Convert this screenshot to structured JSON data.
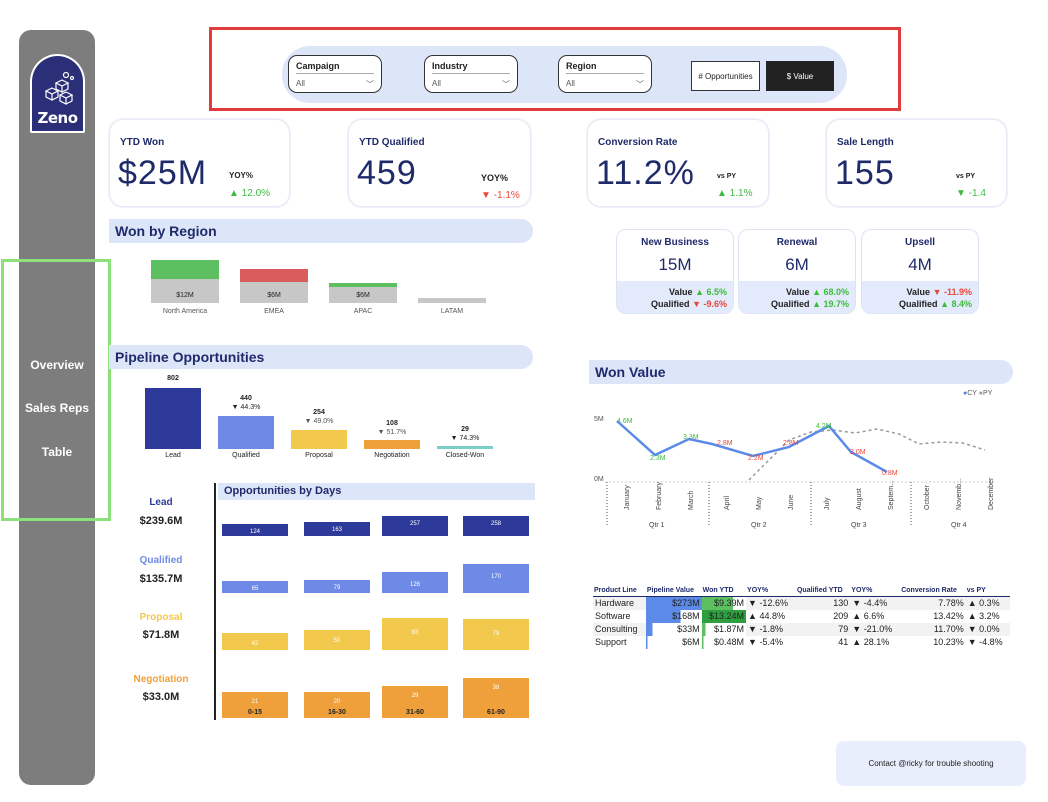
{
  "app": {
    "brand": "Zeno"
  },
  "nav": {
    "items": [
      "Overview",
      "Sales Reps",
      "Table"
    ]
  },
  "filters": {
    "campaign": {
      "label": "Campaign",
      "value": "All"
    },
    "industry": {
      "label": "Industry",
      "value": "All"
    },
    "region": {
      "label": "Region",
      "value": "All"
    },
    "toggle_a": "# Opportunities",
    "toggle_b": "$ Value"
  },
  "kpis": {
    "ytd_won": {
      "title": "YTD Won",
      "value": "$25M",
      "sub": "YOY%",
      "delta": "▲ 12.0%"
    },
    "ytd_qualified": {
      "title": "YTD Qualified",
      "value": "459",
      "sub": "YOY%",
      "delta": "▼ -1.1%"
    },
    "conversion": {
      "title": "Conversion Rate",
      "value": "11.2%",
      "sub": "vs PY",
      "delta": "▲ 1.1%"
    },
    "sale_length": {
      "title": "Sale Length",
      "value": "155",
      "sub": "vs PY",
      "delta": "▼ -1.4"
    }
  },
  "segments": [
    {
      "title": "New Business",
      "value": "15M",
      "value_label": "Value",
      "value_delta": "▲ 6.5%",
      "qual_label": "Qualified",
      "qual_delta": "▼ -9.6%"
    },
    {
      "title": "Renewal",
      "value": "6M",
      "value_label": "Value",
      "value_delta": "▲ 68.0%",
      "qual_label": "Qualified",
      "qual_delta": "▲ 19.7%"
    },
    {
      "title": "Upsell",
      "value": "4M",
      "value_label": "Value",
      "value_delta": "▼ -11.9%",
      "qual_label": "Qualified",
      "qual_delta": "▲ 8.4%"
    }
  ],
  "won_by_region": {
    "title": "Won by Region",
    "regions": [
      {
        "name": "North America",
        "label": "$12M"
      },
      {
        "name": "EMEA",
        "label": "$6M"
      },
      {
        "name": "APAC",
        "label": "$6M"
      },
      {
        "name": "LATAM",
        "label": ""
      }
    ]
  },
  "pipeline": {
    "title": "Pipeline Opportunities",
    "stages": [
      {
        "name": "Lead",
        "value": "802",
        "change": ""
      },
      {
        "name": "Qualified",
        "value": "440",
        "change": "▼ 44.3%"
      },
      {
        "name": "Proposal",
        "value": "254",
        "change": "▼ 49.0%"
      },
      {
        "name": "Negotiation",
        "value": "108",
        "change": "▼ 51.7%"
      },
      {
        "name": "Closed-Won",
        "value": "29",
        "change": "▼ 74.3%"
      }
    ]
  },
  "stage_values": [
    {
      "name": "Lead",
      "value": "$239.6M"
    },
    {
      "name": "Qualified",
      "value": "$135.7M"
    },
    {
      "name": "Proposal",
      "value": "$71.8M"
    },
    {
      "name": "Negotiation",
      "value": "$33.0M"
    }
  ],
  "opps_by_days": {
    "title": "Opportunities by Days",
    "buckets": [
      "0-15",
      "16-30",
      "31-60",
      "61-90"
    ],
    "rows": [
      {
        "stage": "Lead",
        "values": [
          "124",
          "163",
          "257",
          "258"
        ]
      },
      {
        "stage": "Qualified",
        "values": [
          "65",
          "79",
          "126",
          "170"
        ]
      },
      {
        "stage": "Proposal",
        "values": [
          "42",
          "50",
          "83",
          "79"
        ]
      },
      {
        "stage": "Negotiation",
        "values": [
          "21",
          "20",
          "29",
          "38"
        ]
      }
    ]
  },
  "won_value": {
    "title": "Won Value",
    "legend": [
      "CY",
      "PY"
    ],
    "y_ticks": [
      "5M",
      "0M"
    ],
    "months": [
      "January",
      "February",
      "March",
      "April",
      "May",
      "June",
      "July",
      "August",
      "Septem...",
      "October",
      "Novemb...",
      "December"
    ],
    "quarters": [
      "Qtr 1",
      "Qtr 2",
      "Qtr 3",
      "Qtr 4"
    ],
    "cy_labels": [
      "4.6M",
      "2.3M",
      "3.3M",
      "2.8M",
      "2.2M",
      "2.8M",
      "4.2M",
      "2.0M",
      "0.8M"
    ]
  },
  "product_table": {
    "headers": [
      "Product Line",
      "Pipeline Value",
      "Won YTD",
      "YOY%",
      "Qualified YTD",
      "YOY%",
      "Conversion Rate",
      "vs PY"
    ],
    "rows": [
      {
        "product": "Hardware",
        "pipeline": "$273M",
        "won": "$9.39M",
        "yoy": "▼ -12.6%",
        "qual": "130",
        "qyoy": "▼ -4.4%",
        "conv": "7.78%",
        "vspy": "▲ 0.3%"
      },
      {
        "product": "Software",
        "pipeline": "$168M",
        "won": "$13.24M",
        "yoy": "▲ 44.8%",
        "qual": "209",
        "qyoy": "▲ 6.6%",
        "conv": "13.42%",
        "vspy": "▲ 3.2%"
      },
      {
        "product": "Consulting",
        "pipeline": "$33M",
        "won": "$1.87M",
        "yoy": "▼ -1.8%",
        "qual": "79",
        "qyoy": "▼ -21.0%",
        "conv": "11.70%",
        "vspy": "▼ 0.0%"
      },
      {
        "product": "Support",
        "pipeline": "$6M",
        "won": "$0.48M",
        "yoy": "▼ -5.4%",
        "qual": "41",
        "qyoy": "▲ 28.1%",
        "conv": "10.23%",
        "vspy": "▼ -4.8%"
      }
    ]
  },
  "contact": "Contact @ricky for trouble shooting",
  "colors": {
    "navy": "#2b2f77",
    "accent": "#dde5f8",
    "up": "#3dbb3d",
    "down": "#e8473b",
    "lead": "#2e3a99",
    "qualified": "#6f8ae6",
    "proposal": "#f2c94c",
    "negotiation": "#f0a03a"
  }
}
